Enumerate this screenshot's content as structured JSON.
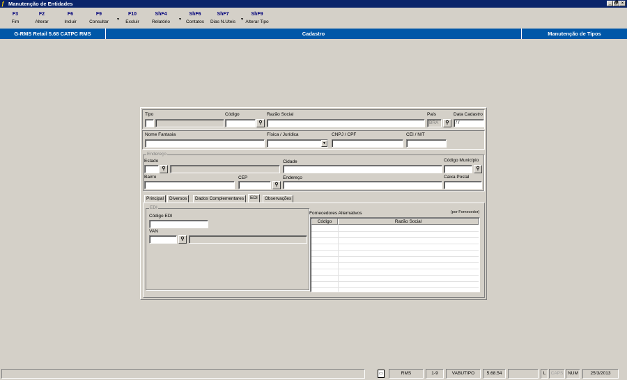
{
  "window": {
    "title": "Manutenção de Entidades",
    "controls": [
      "_",
      "🗗",
      "×"
    ]
  },
  "toolbar": [
    {
      "key": "F3",
      "label": "Fim",
      "dropdown": false
    },
    {
      "key": "F2",
      "label": "Alterar",
      "dropdown": false
    },
    {
      "key": "F6",
      "label": "Incluir",
      "dropdown": false
    },
    {
      "key": "F9",
      "label": "Consultar",
      "dropdown": true
    },
    {
      "key": "F10",
      "label": "Excluir",
      "dropdown": false
    },
    {
      "key": "ShF4",
      "label": "Relatório",
      "dropdown": true
    },
    {
      "key": "ShF6",
      "label": "Contatos",
      "dropdown": false
    },
    {
      "key": "ShF7",
      "label": "Dias N.Uteis",
      "dropdown": true
    },
    {
      "key": "ShF9",
      "label": "Alterar Tipo",
      "dropdown": false
    }
  ],
  "header": {
    "left": "G-RMS Retail 5.68 CATPC RMS",
    "center": "Cadastro",
    "right": "Manutenção de Tipos"
  },
  "form": {
    "tipo_label": "Tipo",
    "tipo_value": "",
    "tipo_desc": "",
    "codigo_label": "Código",
    "codigo_value": "",
    "razao_label": "Razão Social",
    "razao_value": "",
    "pais_label": "País",
    "pais_value": "BRA",
    "data_label": "Data Cadastro",
    "data_value": " / /",
    "fantasia_label": "Nome Fantasia",
    "fantasia_value": "",
    "fisica_label": "Física / Jurídica",
    "fisica_value": "",
    "cnpj_label": "CNPJ / CPF",
    "cnpj_value": "",
    "cei_label": "CEI / NIT",
    "cei_value": "",
    "endereco_group": "Endereço",
    "estado_label": "Estado",
    "estado_value": "",
    "estado_desc": "",
    "cidade_label": "Cidade",
    "cidade_value": "",
    "codmun_label": "Código Município",
    "codmun_value": "",
    "bairro_label": "Bairro",
    "bairro_value": "",
    "cep_label": "CEP",
    "cep_value": "",
    "endereco_label": "Endereço",
    "endereco_value": "",
    "caixa_label": "Caixa Postal",
    "caixa_value": ""
  },
  "tabs": [
    {
      "label": "Principal",
      "active": false
    },
    {
      "label": "Diversos",
      "active": false
    },
    {
      "label": "Dados Complementares",
      "active": false
    },
    {
      "label": "EDI",
      "active": true
    },
    {
      "label": "Observações",
      "active": false
    }
  ],
  "edi": {
    "group": "EDI",
    "codigo_label": "Código EDI",
    "codigo_value": "",
    "van_label": "VAN",
    "van_value": "",
    "van_desc": "",
    "fornecedores_label": "Fornecedores Alternativos",
    "por_fornecedor": "(por Fornecedor)",
    "columns": [
      "Código",
      "Razão Social"
    ],
    "rows": [
      [
        "",
        ""
      ],
      [
        "",
        ""
      ],
      [
        "",
        ""
      ],
      [
        "",
        ""
      ],
      [
        "",
        ""
      ],
      [
        "",
        ""
      ],
      [
        "",
        ""
      ],
      [
        "",
        ""
      ],
      [
        "",
        ""
      ],
      [
        "",
        ""
      ]
    ]
  },
  "status": {
    "rms": "RMS",
    "page": "1-9",
    "user": "VABUTIPO",
    "version": "5.68.54",
    "blank": "",
    "l": "L",
    "caps": "CAPS",
    "num": "NUM",
    "date": "25/3/2013"
  },
  "icons": {
    "binoculars": "binoculars-icon",
    "app": "app-icon",
    "clipboard": "clipboard-icon"
  }
}
